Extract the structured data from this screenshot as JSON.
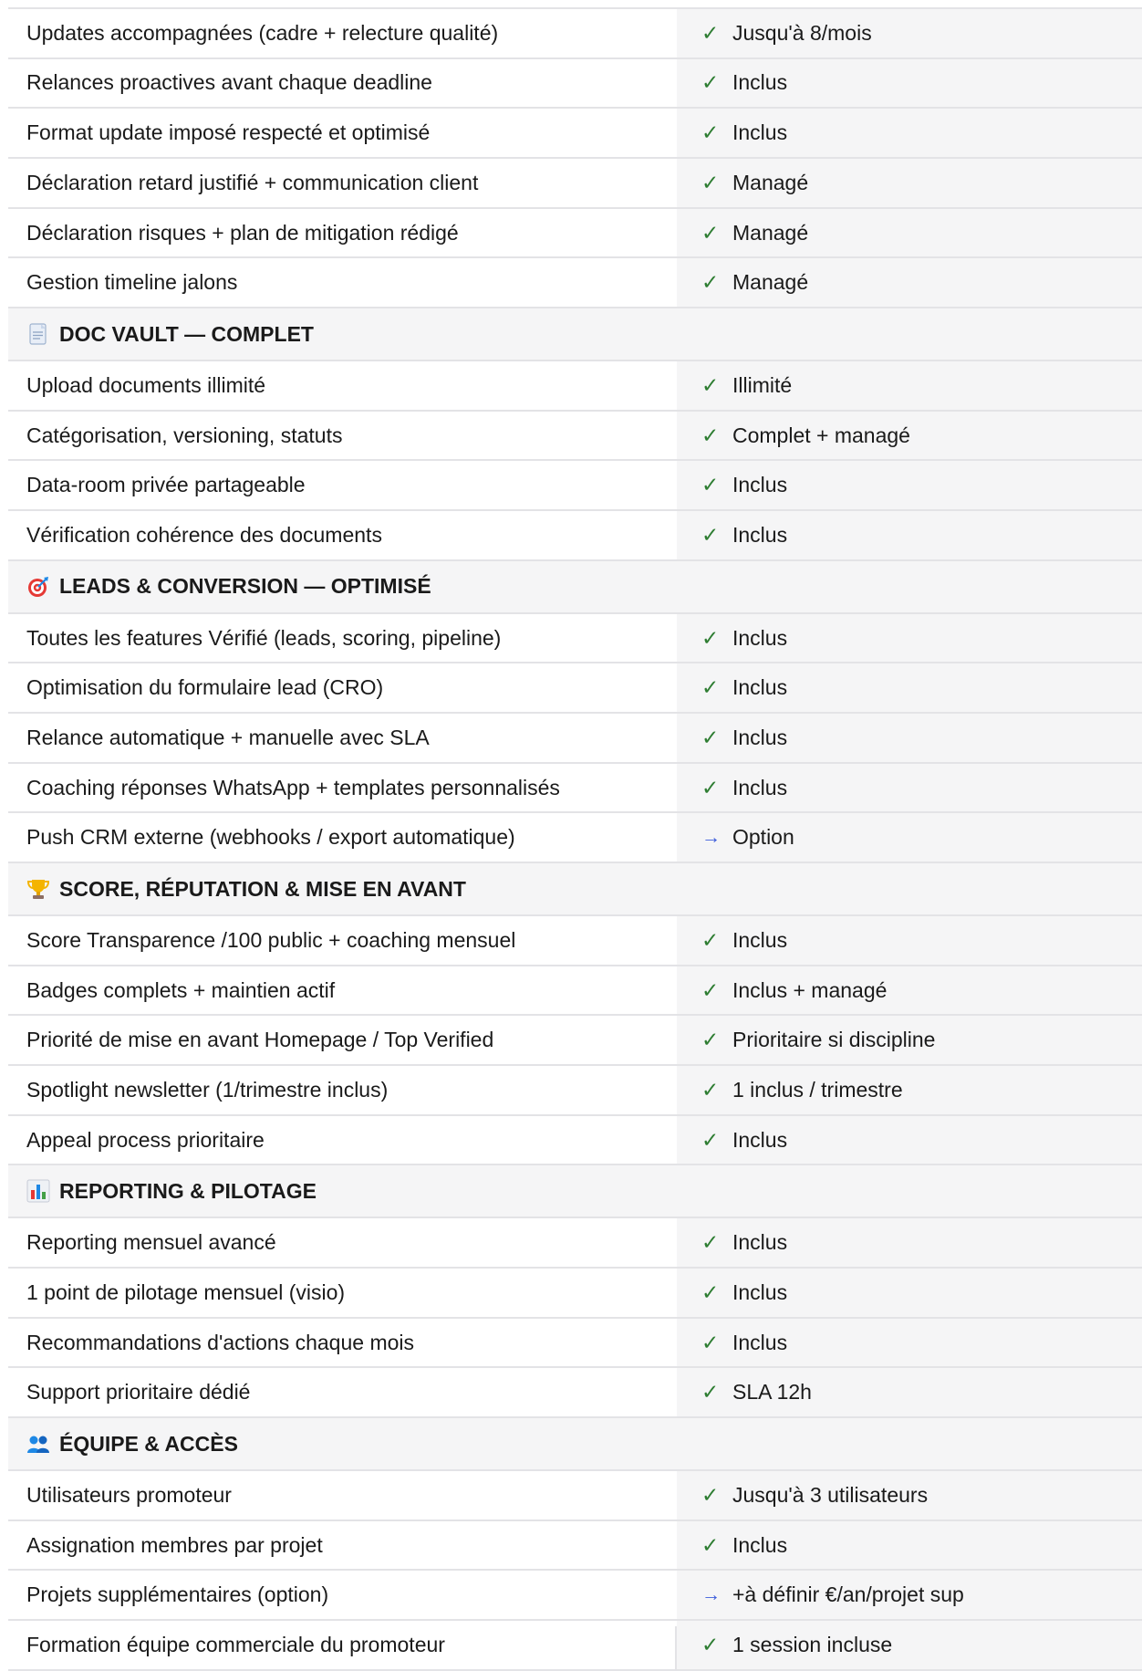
{
  "sections": [
    {
      "title": "",
      "icon": "",
      "rows": [
        {
          "label": "Updates accompagnées (cadre + relecture qualité)",
          "mark": "check",
          "value": "Jusqu'à 8/mois"
        },
        {
          "label": "Relances proactives avant chaque deadline",
          "mark": "check",
          "value": "Inclus"
        },
        {
          "label": "Format update imposé respecté et optimisé",
          "mark": "check",
          "value": "Inclus"
        },
        {
          "label": "Déclaration retard justifié + communication client",
          "mark": "check",
          "value": "Managé"
        },
        {
          "label": "Déclaration risques + plan de mitigation rédigé",
          "mark": "check",
          "value": "Managé"
        },
        {
          "label": "Gestion timeline jalons",
          "mark": "check",
          "value": "Managé"
        }
      ]
    },
    {
      "title": "DOC VAULT — COMPLET",
      "icon": "document-icon",
      "rows": [
        {
          "label": "Upload documents illimité",
          "mark": "check",
          "value": "Illimité"
        },
        {
          "label": "Catégorisation, versioning, statuts",
          "mark": "check",
          "value": "Complet + managé"
        },
        {
          "label": "Data-room privée partageable",
          "mark": "check",
          "value": "Inclus"
        },
        {
          "label": "Vérification cohérence des documents",
          "mark": "check",
          "value": "Inclus"
        }
      ]
    },
    {
      "title": "LEADS & CONVERSION — OPTIMISÉ",
      "icon": "target-icon",
      "rows": [
        {
          "label": "Toutes les features Vérifié (leads, scoring, pipeline)",
          "mark": "check",
          "value": "Inclus"
        },
        {
          "label": "Optimisation du formulaire lead (CRO)",
          "mark": "check",
          "value": "Inclus"
        },
        {
          "label": "Relance automatique + manuelle avec SLA",
          "mark": "check",
          "value": "Inclus"
        },
        {
          "label": "Coaching réponses WhatsApp + templates personnalisés",
          "mark": "check",
          "value": "Inclus"
        },
        {
          "label": "Push CRM externe (webhooks / export automatique)",
          "mark": "arrow",
          "value": "Option"
        }
      ]
    },
    {
      "title": "SCORE, RÉPUTATION & MISE EN AVANT",
      "icon": "trophy-icon",
      "rows": [
        {
          "label": "Score Transparence /100 public + coaching mensuel",
          "mark": "check",
          "value": "Inclus"
        },
        {
          "label": "Badges complets + maintien actif",
          "mark": "check",
          "value": "Inclus + managé"
        },
        {
          "label": "Priorité de mise en avant Homepage / Top Verified",
          "mark": "check",
          "value": "Prioritaire si discipline"
        },
        {
          "label": "Spotlight newsletter (1/trimestre inclus)",
          "mark": "check",
          "value": "1 inclus / trimestre"
        },
        {
          "label": "Appeal process prioritaire",
          "mark": "check",
          "value": "Inclus"
        }
      ]
    },
    {
      "title": "REPORTING & PILOTAGE",
      "icon": "bar-chart-icon",
      "rows": [
        {
          "label": "Reporting mensuel avancé",
          "mark": "check",
          "value": "Inclus"
        },
        {
          "label": "1 point de pilotage mensuel (visio)",
          "mark": "check",
          "value": "Inclus"
        },
        {
          "label": "Recommandations d'actions chaque mois",
          "mark": "check",
          "value": "Inclus"
        },
        {
          "label": "Support prioritaire dédié",
          "mark": "check",
          "value": "SLA 12h"
        }
      ]
    },
    {
      "title": "ÉQUIPE & ACCÈS",
      "icon": "people-icon",
      "rows": [
        {
          "label": "Utilisateurs promoteur",
          "mark": "check",
          "value": "Jusqu'à 3 utilisateurs"
        },
        {
          "label": "Assignation membres par projet",
          "mark": "check",
          "value": "Inclus"
        },
        {
          "label": "Projets supplémentaires (option)",
          "mark": "arrow",
          "value": "+à définir €/an/projet sup"
        },
        {
          "label": "Formation équipe commerciale du promoteur",
          "mark": "check",
          "value": "1 session incluse"
        }
      ]
    }
  ],
  "glyphs": {
    "check": "✓",
    "arrow": "→"
  },
  "colors": {
    "check": "#2e7d32",
    "arrow": "#3b5bdb",
    "border": "#e3e3e6",
    "value_bg": "#f5f5f6",
    "section_bg": "#f5f5f6"
  }
}
